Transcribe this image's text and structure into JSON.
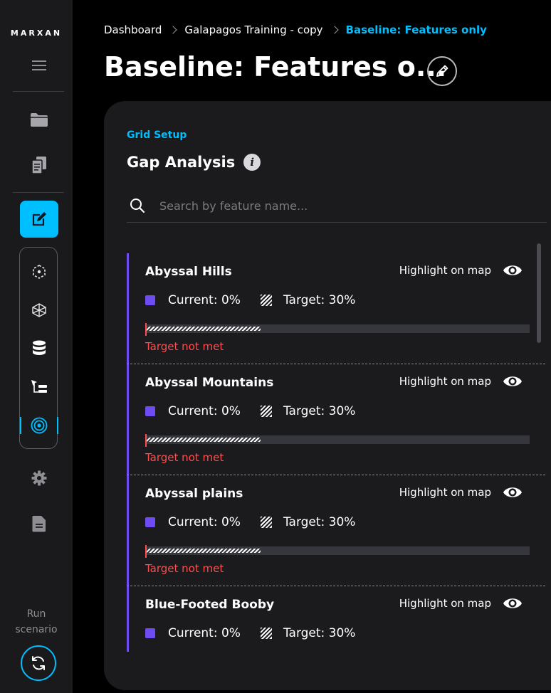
{
  "app": {
    "logo": "MARXAN"
  },
  "sidebar": {
    "run_label_line1": "Run",
    "run_label_line2": "scenario"
  },
  "breadcrumb": {
    "items": [
      "Dashboard",
      "Galapagos Training - copy",
      "Baseline: Features only"
    ]
  },
  "page": {
    "title": "Baseline: Features o..."
  },
  "panel": {
    "section": "Grid Setup",
    "heading": "Gap Analysis",
    "search_placeholder": "Search by feature name..."
  },
  "features": [
    {
      "name": "Abyssal Hills",
      "highlight_label": "Highlight on map",
      "current_label": "Current: 0%",
      "target_label": "Target: 30%",
      "status": "Target not met",
      "current_pct": 0,
      "target_pct": 30
    },
    {
      "name": "Abyssal Mountains",
      "highlight_label": "Highlight on map",
      "current_label": "Current: 0%",
      "target_label": "Target: 30%",
      "status": "Target not met",
      "current_pct": 0,
      "target_pct": 30
    },
    {
      "name": "Abyssal plains",
      "highlight_label": "Highlight on map",
      "current_label": "Current: 0%",
      "target_label": "Target: 30%",
      "status": "Target not met",
      "current_pct": 0,
      "target_pct": 30
    },
    {
      "name": "Blue-Footed Booby",
      "highlight_label": "Highlight on map",
      "current_label": "Current: 0%",
      "target_label": "Target: 30%",
      "status": "",
      "current_pct": 0,
      "target_pct": 30
    }
  ],
  "colors": {
    "accent": "#00bfff",
    "current_swatch": "#6f4cf2",
    "error": "#ff4d4d"
  },
  "icons": {
    "menu": "menu-icon",
    "folder": "folder-icon",
    "documents": "documents-icon",
    "edit": "edit-icon",
    "planning_units": "planning-units-icon",
    "features": "features-icon",
    "database": "database-icon",
    "tree": "tree-icon",
    "target": "target-icon",
    "settings": "gear-icon",
    "report": "report-icon",
    "run": "refresh-icon",
    "pencil": "pencil-icon",
    "info": "info-icon",
    "search": "search-icon",
    "eye": "eye-icon"
  }
}
